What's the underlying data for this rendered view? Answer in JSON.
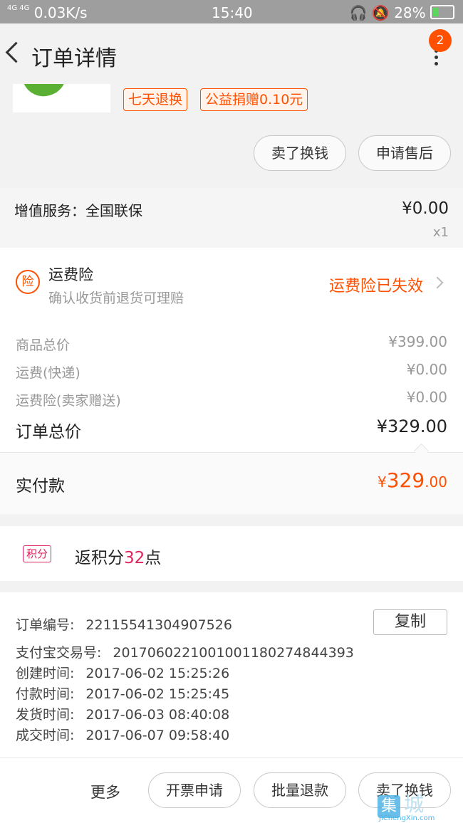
{
  "status_bar": {
    "signal": "4G 4G",
    "speed": "0.03K/s",
    "time": "15:40",
    "battery": "28%"
  },
  "header": {
    "back_icon": "‹",
    "title": "订单详情",
    "badge": "2"
  },
  "product": {
    "tags": [
      "七天退换",
      "公益捐赠0.10元"
    ],
    "actions": [
      "卖了换钱",
      "申请售后"
    ]
  },
  "service": {
    "label": "增值服务：全国联保",
    "price": "¥0.00",
    "qty": "x1"
  },
  "insurance": {
    "icon_text": "险",
    "title": "运费险",
    "subtitle": "确认收货前退货可理赔",
    "status": "运费险已失效"
  },
  "summary": {
    "rows": [
      {
        "label": "商品总价",
        "value": "¥399.00"
      },
      {
        "label": "运费(快递)",
        "value": "¥0.00"
      },
      {
        "label": "运费险(卖家赠送)",
        "value": "¥0.00"
      }
    ],
    "total_label": "订单总价",
    "total_value": "¥329.00",
    "paid_label": "实付款",
    "paid_symbol": "¥",
    "paid_int": "329",
    "paid_dec": ".00"
  },
  "points": {
    "badge": "积分",
    "prefix": "返积分",
    "number": "32",
    "suffix": "点"
  },
  "order_info": {
    "copy_label": "复制",
    "lines": [
      {
        "label": "订单编号:",
        "value": "22115541304907526"
      },
      {
        "label": "支付宝交易号:",
        "value": "2017060221001001180274844393"
      },
      {
        "label": "创建时间:",
        "value": "2017-06-02 15:25:26"
      },
      {
        "label": "付款时间:",
        "value": "2017-06-02 15:25:45"
      },
      {
        "label": "发货时间:",
        "value": "2017-06-03 08:40:08"
      },
      {
        "label": "成交时间:",
        "value": "2017-06-07 09:58:40"
      }
    ]
  },
  "bottom_bar": {
    "more": "更多",
    "buttons": [
      "开票申请",
      "批量退款",
      "卖了换钱"
    ]
  },
  "watermark": {
    "logo": "集",
    "cn": "城",
    "site": "JiChengXin.com"
  },
  "colors": {
    "accent": "#ff5000",
    "points": "#e0245e"
  }
}
